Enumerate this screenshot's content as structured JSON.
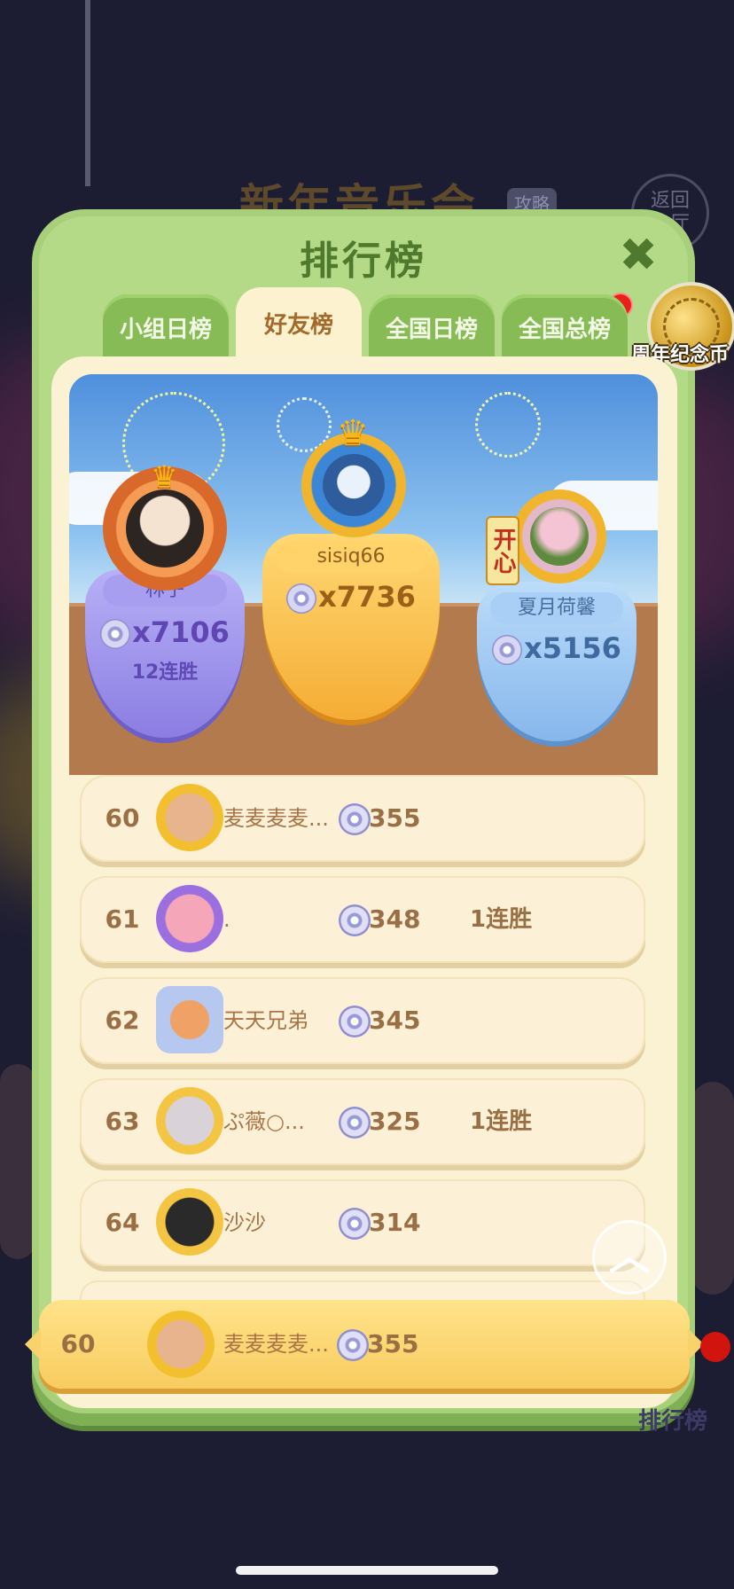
{
  "background": {
    "title": "新年音乐会",
    "tag": "攻略",
    "back_button": "返回\n大厅",
    "corner_label": "排行榜"
  },
  "modal": {
    "title": "排行榜",
    "close_icon": "close-icon",
    "coin_label": "周年纪念币"
  },
  "tabs": [
    {
      "label": "小组日榜",
      "active": false
    },
    {
      "label": "好友榜",
      "active": true
    },
    {
      "label": "全国日榜",
      "active": false
    },
    {
      "label": "全国总榜",
      "active": false
    }
  ],
  "podium": {
    "first": {
      "name": "sisiq66",
      "score": "x7736"
    },
    "second": {
      "name": "林子",
      "score": "x7106",
      "streak": "12连胜"
    },
    "third": {
      "name": "夏月荷馨",
      "score": "x5156",
      "badge": "开心"
    }
  },
  "rows": [
    {
      "rank": "60",
      "name": "麦麦麦麦...",
      "score": "355",
      "streak": ""
    },
    {
      "rank": "61",
      "name": ".",
      "score": "348",
      "streak": "1连胜"
    },
    {
      "rank": "62",
      "name": "天天兄弟",
      "score": "345",
      "streak": ""
    },
    {
      "rank": "63",
      "name": "ぷ薇○...",
      "score": "325",
      "streak": "1连胜"
    },
    {
      "rank": "64",
      "name": "沙沙",
      "score": "314",
      "streak": ""
    }
  ],
  "my_row": {
    "rank": "60",
    "name": "麦麦麦麦...",
    "score": "355"
  },
  "colors": {
    "modal_green": "#a8d07a",
    "tab_active_bg": "#fdf2cf",
    "first_gold": "#f7b63c",
    "second_purple": "#9a8de8",
    "third_blue": "#8fc0f0",
    "rank_text": "#9b6f45"
  }
}
